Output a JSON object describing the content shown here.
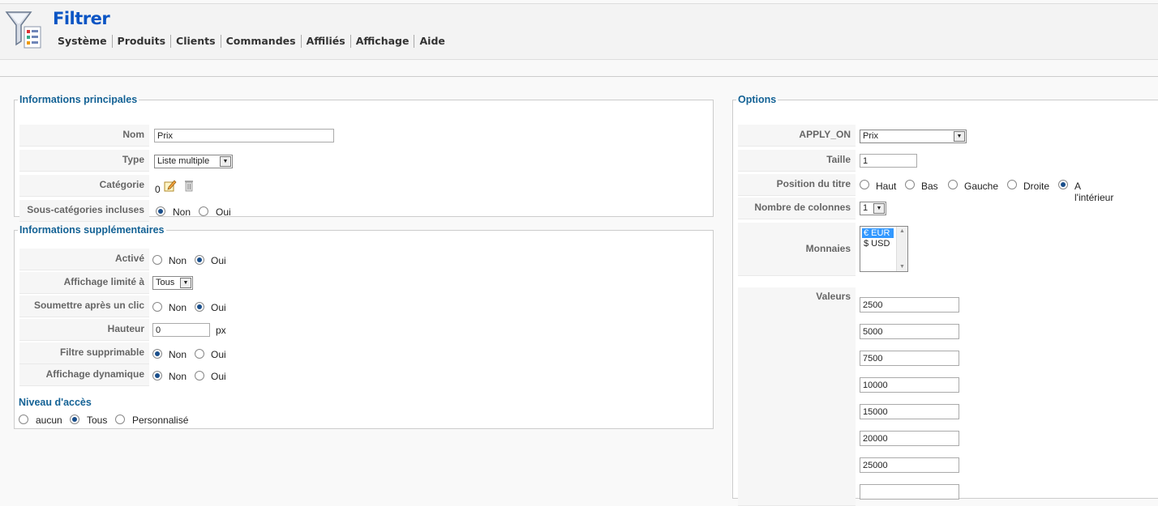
{
  "header": {
    "title": "Filtrer",
    "logo_icon": "filter-funnel-icon",
    "menu": [
      "Système",
      "Produits",
      "Clients",
      "Commandes",
      "Affiliés",
      "Affichage",
      "Aide"
    ]
  },
  "main_info": {
    "legend": "Informations principales",
    "nom_label": "Nom",
    "nom_value": "Prix",
    "type_label": "Type",
    "type_value": "Liste multiple",
    "categorie_label": "Catégorie",
    "categorie_value": "0",
    "subcat_label": "Sous-catégories incluses",
    "subcat_options": [
      "Non",
      "Oui"
    ],
    "subcat_selected": "Non"
  },
  "extra_info": {
    "legend": "Informations supplémentaires",
    "active_label": "Activé",
    "active_options": [
      "Non",
      "Oui"
    ],
    "active_selected": "Oui",
    "display_limit_label": "Affichage limité à",
    "display_limit_value": "Tous",
    "submit_label": "Soumettre après un clic",
    "submit_options": [
      "Non",
      "Oui"
    ],
    "submit_selected": "Oui",
    "height_label": "Hauteur",
    "height_value": "0",
    "height_unit": "px",
    "removable_label": "Filtre supprimable",
    "removable_options": [
      "Non",
      "Oui"
    ],
    "removable_selected": "Non",
    "dynamic_label": "Affichage dynamique",
    "dynamic_options": [
      "Non",
      "Oui"
    ],
    "dynamic_selected": "Non",
    "access_title": "Niveau d'accès",
    "access_options": [
      "aucun",
      "Tous",
      "Personnalisé"
    ],
    "access_selected": "Tous"
  },
  "options": {
    "legend": "Options",
    "apply_on_label": "APPLY_ON",
    "apply_on_value": "Prix",
    "size_label": "Taille",
    "size_value": "1",
    "title_pos_label": "Position du titre",
    "title_pos_options": [
      "Haut",
      "Bas",
      "Gauche",
      "Droite",
      "A l'intérieur"
    ],
    "title_pos_selected": "A l'intérieur",
    "columns_label": "Nombre de colonnes",
    "columns_value": "1",
    "currencies_label": "Monnaies",
    "currencies": [
      "€ EUR",
      "$ USD"
    ],
    "currency_selected": "€ EUR",
    "values_label": "Valeurs",
    "values": [
      "2500",
      "5000",
      "7500",
      "10000",
      "15000",
      "20000",
      "25000",
      ""
    ]
  },
  "colors": {
    "title": "#0b55c4",
    "legend": "#146295",
    "selected": "#3399ff"
  }
}
